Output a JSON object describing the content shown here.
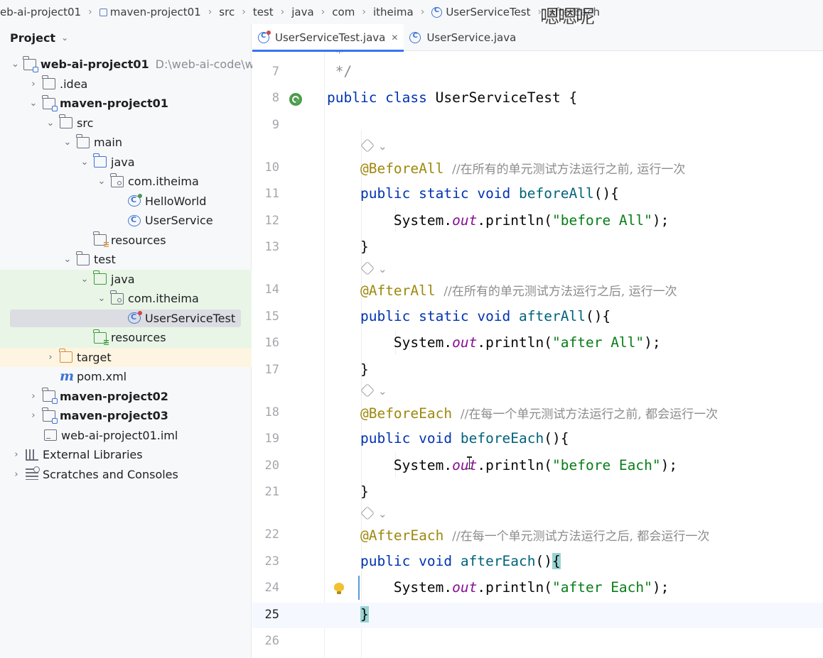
{
  "breadcrumb": {
    "items": [
      "eb-ai-project01",
      "maven-project01",
      "src",
      "test",
      "java",
      "com",
      "itheima",
      "UserServiceTest",
      "afterEach"
    ],
    "watermark": "嗯嗯呢"
  },
  "project_panel": {
    "title": "Project",
    "tree": [
      {
        "label": "web-ai-project01",
        "path": "D:\\web-ai-code\\we",
        "bold": true
      },
      {
        "label": ".idea"
      },
      {
        "label": "maven-project01",
        "bold": true
      },
      {
        "label": "src"
      },
      {
        "label": "main"
      },
      {
        "label": "java"
      },
      {
        "label": "com.itheima"
      },
      {
        "label": "HelloWorld"
      },
      {
        "label": "UserService"
      },
      {
        "label": "resources"
      },
      {
        "label": "test"
      },
      {
        "label": "java"
      },
      {
        "label": "com.itheima"
      },
      {
        "label": "UserServiceTest"
      },
      {
        "label": "resources"
      },
      {
        "label": "target"
      },
      {
        "label": "pom.xml"
      },
      {
        "label": "maven-project02",
        "bold": true
      },
      {
        "label": "maven-project03",
        "bold": true
      },
      {
        "label": "web-ai-project01.iml"
      },
      {
        "label": "External Libraries"
      },
      {
        "label": "Scratches and Consoles"
      }
    ]
  },
  "tabs": [
    {
      "label": "UserServiceTest.java",
      "active": true
    },
    {
      "label": "UserService.java",
      "active": false
    }
  ],
  "editor": {
    "line_numbers": [
      "7",
      "8",
      "9",
      "10",
      "11",
      "12",
      "13",
      "14",
      "15",
      "16",
      "17",
      "18",
      "19",
      "20",
      "21",
      "22",
      "23",
      "24",
      "25",
      "26"
    ],
    "comments": {
      "c10": "//在所有的单元测试方法运行之前, 运行一次",
      "c14": "//在所有的单元测试方法运行之后, 运行一次",
      "c18": "//在每一个单元测试方法运行之前, 都会运行一次",
      "c22": "//在每一个单元测试方法运行之后, 都会运行一次"
    },
    "strings": {
      "s12": "\"before All\"",
      "s16": "\"after All\"",
      "s20": "\"before Each\"",
      "s24": "\"after Each\""
    },
    "identifiers": {
      "class_name": "UserServiceTest",
      "m11": "beforeAll",
      "m15": "afterAll",
      "m19": "beforeEach",
      "m23": "afterEach",
      "a10": "@BeforeAll",
      "a14": "@AfterAll",
      "a18": "@BeforeEach",
      "a22": "@AfterEach"
    },
    "current_line": "25"
  },
  "colors": {
    "keyword": "#0033b3",
    "annotation": "#9e880d",
    "string": "#067d17",
    "comment": "#8c8c8c",
    "accent": "#3574f0",
    "selection": "#dcdde3"
  }
}
